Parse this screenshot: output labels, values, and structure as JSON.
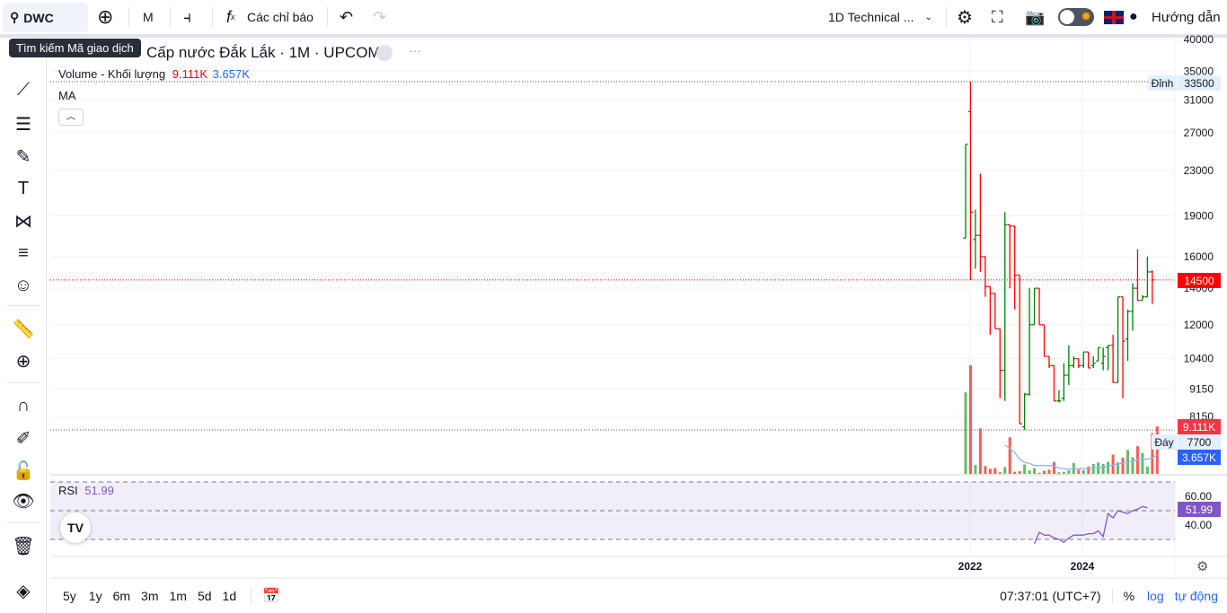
{
  "toolbar": {
    "symbol": "DWC",
    "interval": "M",
    "indicators_label": "Các chỉ báo",
    "layout_name": "1D Technical ...",
    "guide_label": "Hướng dẫn",
    "search_tooltip": "Tìm kiếm Mã giao dịch"
  },
  "chart": {
    "title": "Cấp nước Đắk Lắk · 1M · UPCOM",
    "volume_label": "Volume - Khối lượng",
    "volume_value": "9.111K",
    "volume_ma_value": "3.657K",
    "ma_label": "MA",
    "rsi_label": "RSI",
    "rsi_value": "51.99",
    "high_label": "Đỉnh",
    "high_value": "33500",
    "low_label": "Đáy",
    "low_value": "7700",
    "last_price": "14500",
    "colors": {
      "up": "#089981",
      "bar_up": "#008000",
      "bar_down": "#ff0000",
      "volume_tag": "#f23645",
      "ma_tag": "#2962ff",
      "rsi": "#7e57c2"
    }
  },
  "chart_data": {
    "type": "ohlc",
    "scale": "log",
    "price_ticks": [
      "40000",
      "35000",
      "31000",
      "27000",
      "23000",
      "19000",
      "16000",
      "14000",
      "12000",
      "10400",
      "9150",
      "8150"
    ],
    "time_ticks": [
      "2022",
      "2024"
    ],
    "rsi_ticks": [
      "60.00",
      "40.00"
    ],
    "bars": [
      [
        17300,
        25700,
        17300,
        25700
      ],
      [
        29500,
        33500,
        14500,
        19300
      ],
      [
        17200,
        19500,
        15200,
        17500
      ],
      [
        17500,
        22700,
        15000,
        16000
      ],
      [
        16000,
        16000,
        13500,
        14100
      ],
      [
        14100,
        14100,
        11500,
        13700
      ],
      [
        13700,
        13700,
        11800,
        11800
      ],
      [
        11800,
        11800,
        8800,
        9900
      ],
      [
        9900,
        19300,
        8700,
        18300
      ],
      [
        18300,
        18300,
        14000,
        18200
      ],
      [
        18200,
        18200,
        12800,
        14800
      ],
      [
        14800,
        14800,
        7900,
        7900
      ],
      [
        7800,
        9000,
        7700,
        8950
      ],
      [
        8950,
        14000,
        8900,
        12000
      ],
      [
        12000,
        14000,
        12000,
        14000
      ],
      [
        14000,
        14000,
        12000,
        12000
      ],
      [
        12000,
        12000,
        10500,
        10500
      ],
      [
        10500,
        10500,
        10000,
        10100
      ],
      [
        10100,
        10100,
        8700,
        8700
      ],
      [
        8700,
        9100,
        8650,
        8700
      ],
      [
        8800,
        10200,
        8700,
        9700
      ],
      [
        9700,
        11000,
        9300,
        10100
      ],
      [
        10100,
        10500,
        10000,
        10400
      ],
      [
        10400,
        10400,
        10000,
        10100
      ],
      [
        10100,
        10700,
        10000,
        10700
      ],
      [
        10700,
        10700,
        10000,
        10000
      ],
      [
        10100,
        10500,
        10000,
        10200
      ],
      [
        10300,
        10900,
        10300,
        10900
      ],
      [
        10200,
        10900,
        9900,
        10500
      ],
      [
        10900,
        11000,
        9900,
        11000
      ],
      [
        11000,
        11500,
        9400,
        9400
      ],
      [
        9400,
        13500,
        9400,
        13500
      ],
      [
        13500,
        13500,
        8800,
        11200
      ],
      [
        11300,
        12800,
        10300,
        12700
      ],
      [
        12700,
        14300,
        11700,
        14000
      ],
      [
        14000,
        16500,
        13300,
        13300
      ],
      [
        13300,
        13600,
        13300,
        13500
      ],
      [
        13500,
        16000,
        13500,
        15000
      ],
      [
        15000,
        15100,
        13100,
        14500
      ]
    ],
    "volume_k": [
      15.6,
      20.8,
      1.7,
      8.7,
      1.5,
      1.0,
      1.1,
      0.3,
      1.3,
      7.0,
      0.4,
      0.5,
      1.8,
      0.7,
      1.1,
      0.2,
      0.6,
      0.8,
      2.3,
      0.3,
      0.4,
      0.7,
      2.1,
      0.8,
      0.7,
      1.4,
      1.9,
      2.2,
      1.9,
      2.3,
      3.7,
      2.2,
      3.1,
      4.6,
      3.2,
      5.3,
      4.0,
      1.4,
      7.8,
      9.111
    ],
    "volume_ma_k": [
      null,
      null,
      null,
      null,
      null,
      null,
      null,
      null,
      5.5,
      4.9,
      4.1,
      2.8,
      2.2,
      2.0,
      1.6,
      1.6,
      1.6,
      1.6,
      1.5,
      1.1,
      1.0,
      0.9,
      1.0,
      1.0,
      1.0,
      1.0,
      1.1,
      1.2,
      1.3,
      1.5,
      1.7,
      1.9,
      2.1,
      2.2,
      2.4,
      2.7,
      2.8,
      2.8,
      3.1,
      3.657
    ],
    "rsi": [
      null,
      null,
      null,
      null,
      null,
      null,
      null,
      null,
      null,
      null,
      null,
      null,
      null,
      null,
      27,
      35,
      33,
      33,
      31,
      30,
      28,
      31,
      33,
      33,
      33,
      34,
      34,
      36,
      32,
      48,
      45,
      50,
      49,
      48,
      50,
      51,
      53,
      51.99
    ]
  },
  "bottom": {
    "ranges": [
      "5y",
      "1y",
      "6m",
      "3m",
      "1m",
      "5d",
      "1d"
    ],
    "time": "07:37:01 (UTC+7)",
    "percent": "%",
    "log": "log",
    "auto": "tự động"
  }
}
